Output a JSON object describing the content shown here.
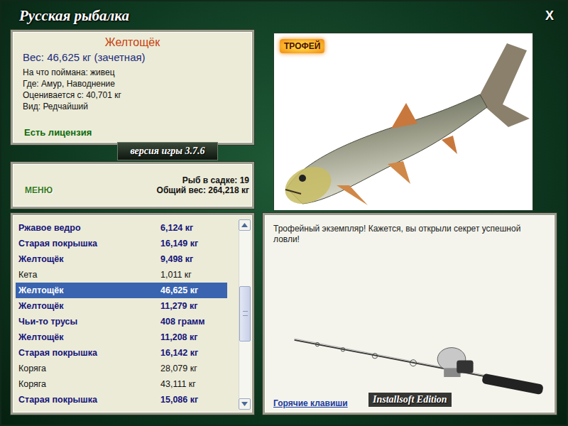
{
  "window": {
    "title": "Русская рыбалка",
    "close": "X"
  },
  "catch": {
    "name": "Желтощёк",
    "weight": "Вес: 46,625 кг (зачетная)",
    "details": [
      "На что поймана: живец",
      "Где: Амур, Наводнение",
      "Оценивается с: 40,701 кг",
      "Вид: Редчайший"
    ],
    "license": "Есть лицензия"
  },
  "version": "версия игры 3.7.6",
  "menu": {
    "button": "МЕНЮ",
    "stats": [
      "Рыб в садке: 19",
      "Общий вес: 264,218 кг"
    ]
  },
  "picture": {
    "badge": "ТРОФЕЙ"
  },
  "catches": [
    {
      "name": "Ржавое ведро",
      "weight": "6,124 кг",
      "emphasized": true,
      "selected": false
    },
    {
      "name": "Старая покрышка",
      "weight": "16,149 кг",
      "emphasized": true,
      "selected": false
    },
    {
      "name": "Желтощёк",
      "weight": "9,498 кг",
      "emphasized": true,
      "selected": false
    },
    {
      "name": "Кета",
      "weight": "1,011 кг",
      "emphasized": false,
      "selected": false
    },
    {
      "name": "Желтощёк",
      "weight": "46,625 кг",
      "emphasized": true,
      "selected": true
    },
    {
      "name": "Желтощёк",
      "weight": "11,279 кг",
      "emphasized": true,
      "selected": false
    },
    {
      "name": "Чьи-то трусы",
      "weight": "408 грамм",
      "emphasized": true,
      "selected": false
    },
    {
      "name": "Желтощёк",
      "weight": "11,208 кг",
      "emphasized": true,
      "selected": false
    },
    {
      "name": "Старая покрышка",
      "weight": "16,142 кг",
      "emphasized": true,
      "selected": false
    },
    {
      "name": "Коряга",
      "weight": "28,079 кг",
      "emphasized": false,
      "selected": false
    },
    {
      "name": "Коряга",
      "weight": "43,111 кг",
      "emphasized": false,
      "selected": false
    },
    {
      "name": "Старая покрышка",
      "weight": "15,086 кг",
      "emphasized": true,
      "selected": false
    }
  ],
  "scrollbar": {
    "thumb_start": 0.33,
    "thumb_size": 0.33
  },
  "description": {
    "text": "Трофейный экземпляр! Кажется, вы открыли секрет успешной ловли!",
    "hotkeys": "Горячие клавиши",
    "edition": "Installsoft Edition"
  }
}
